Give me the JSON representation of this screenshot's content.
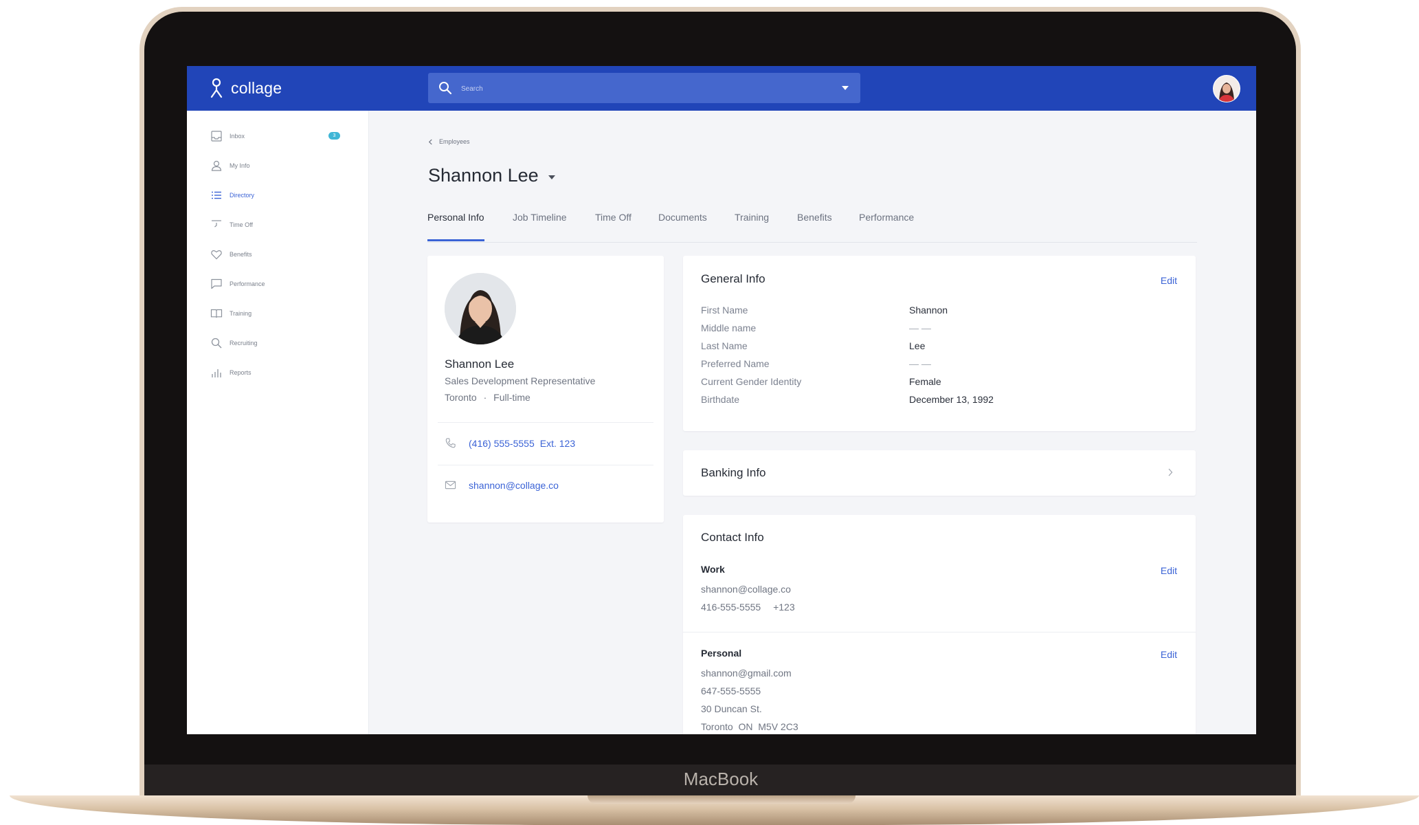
{
  "device": {
    "label": "MacBook"
  },
  "app": {
    "logo_text": "collage",
    "search_placeholder": "Search"
  },
  "sidebar": {
    "items": [
      {
        "label": "Inbox",
        "icon": "inbox-icon",
        "badge": "3"
      },
      {
        "label": "My Info",
        "icon": "person-icon"
      },
      {
        "label": "Directory",
        "icon": "list-icon",
        "active": true
      },
      {
        "label": "Time Off",
        "icon": "clock-icon"
      },
      {
        "label": "Benefits",
        "icon": "heart-icon"
      },
      {
        "label": "Performance",
        "icon": "chat-icon"
      },
      {
        "label": "Training",
        "icon": "book-icon"
      },
      {
        "label": "Recruiting",
        "icon": "search-icon"
      },
      {
        "label": "Reports",
        "icon": "bar-chart-icon"
      }
    ]
  },
  "breadcrumb": {
    "label": "Employees"
  },
  "page": {
    "title": "Shannon Lee"
  },
  "tabs": [
    {
      "label": "Personal Info",
      "active": true
    },
    {
      "label": "Job Timeline"
    },
    {
      "label": "Time Off"
    },
    {
      "label": "Documents"
    },
    {
      "label": "Training"
    },
    {
      "label": "Benefits"
    },
    {
      "label": "Performance"
    }
  ],
  "profile": {
    "name": "Shannon Lee",
    "title": "Sales Development Representative",
    "location": "Toronto",
    "employment": "Full-time",
    "separator": "·",
    "phone": "(416) 555-5555",
    "extension": "Ext. 123",
    "email": "shannon@collage.co"
  },
  "general_info": {
    "title": "General Info",
    "edit_label": "Edit",
    "fields": [
      {
        "label": "First Name",
        "value": "Shannon"
      },
      {
        "label": "Middle name",
        "value": "— —"
      },
      {
        "label": "Last Name",
        "value": "Lee"
      },
      {
        "label": "Preferred Name",
        "value": "— —"
      },
      {
        "label": "Current Gender Identity",
        "value": "Female"
      },
      {
        "label": "Birthdate",
        "value": "December 13, 1992"
      }
    ]
  },
  "banking_info": {
    "title": "Banking Info"
  },
  "contact_info": {
    "title": "Contact Info",
    "work": {
      "title": "Work",
      "edit_label": "Edit",
      "email": "shannon@collage.co",
      "phone": "416-555-5555",
      "extension": "+123"
    },
    "personal": {
      "title": "Personal",
      "edit_label": "Edit",
      "email": "shannon@gmail.com",
      "phone": "647-555-5555",
      "address": "30 Duncan St.",
      "city_line": "Toronto  ON  M5V 2C3"
    }
  },
  "colors": {
    "header_blue": "#2145b8",
    "accent_blue": "#3b63d6",
    "badge_teal": "#3fb6d6",
    "background": "#f4f5f8"
  }
}
